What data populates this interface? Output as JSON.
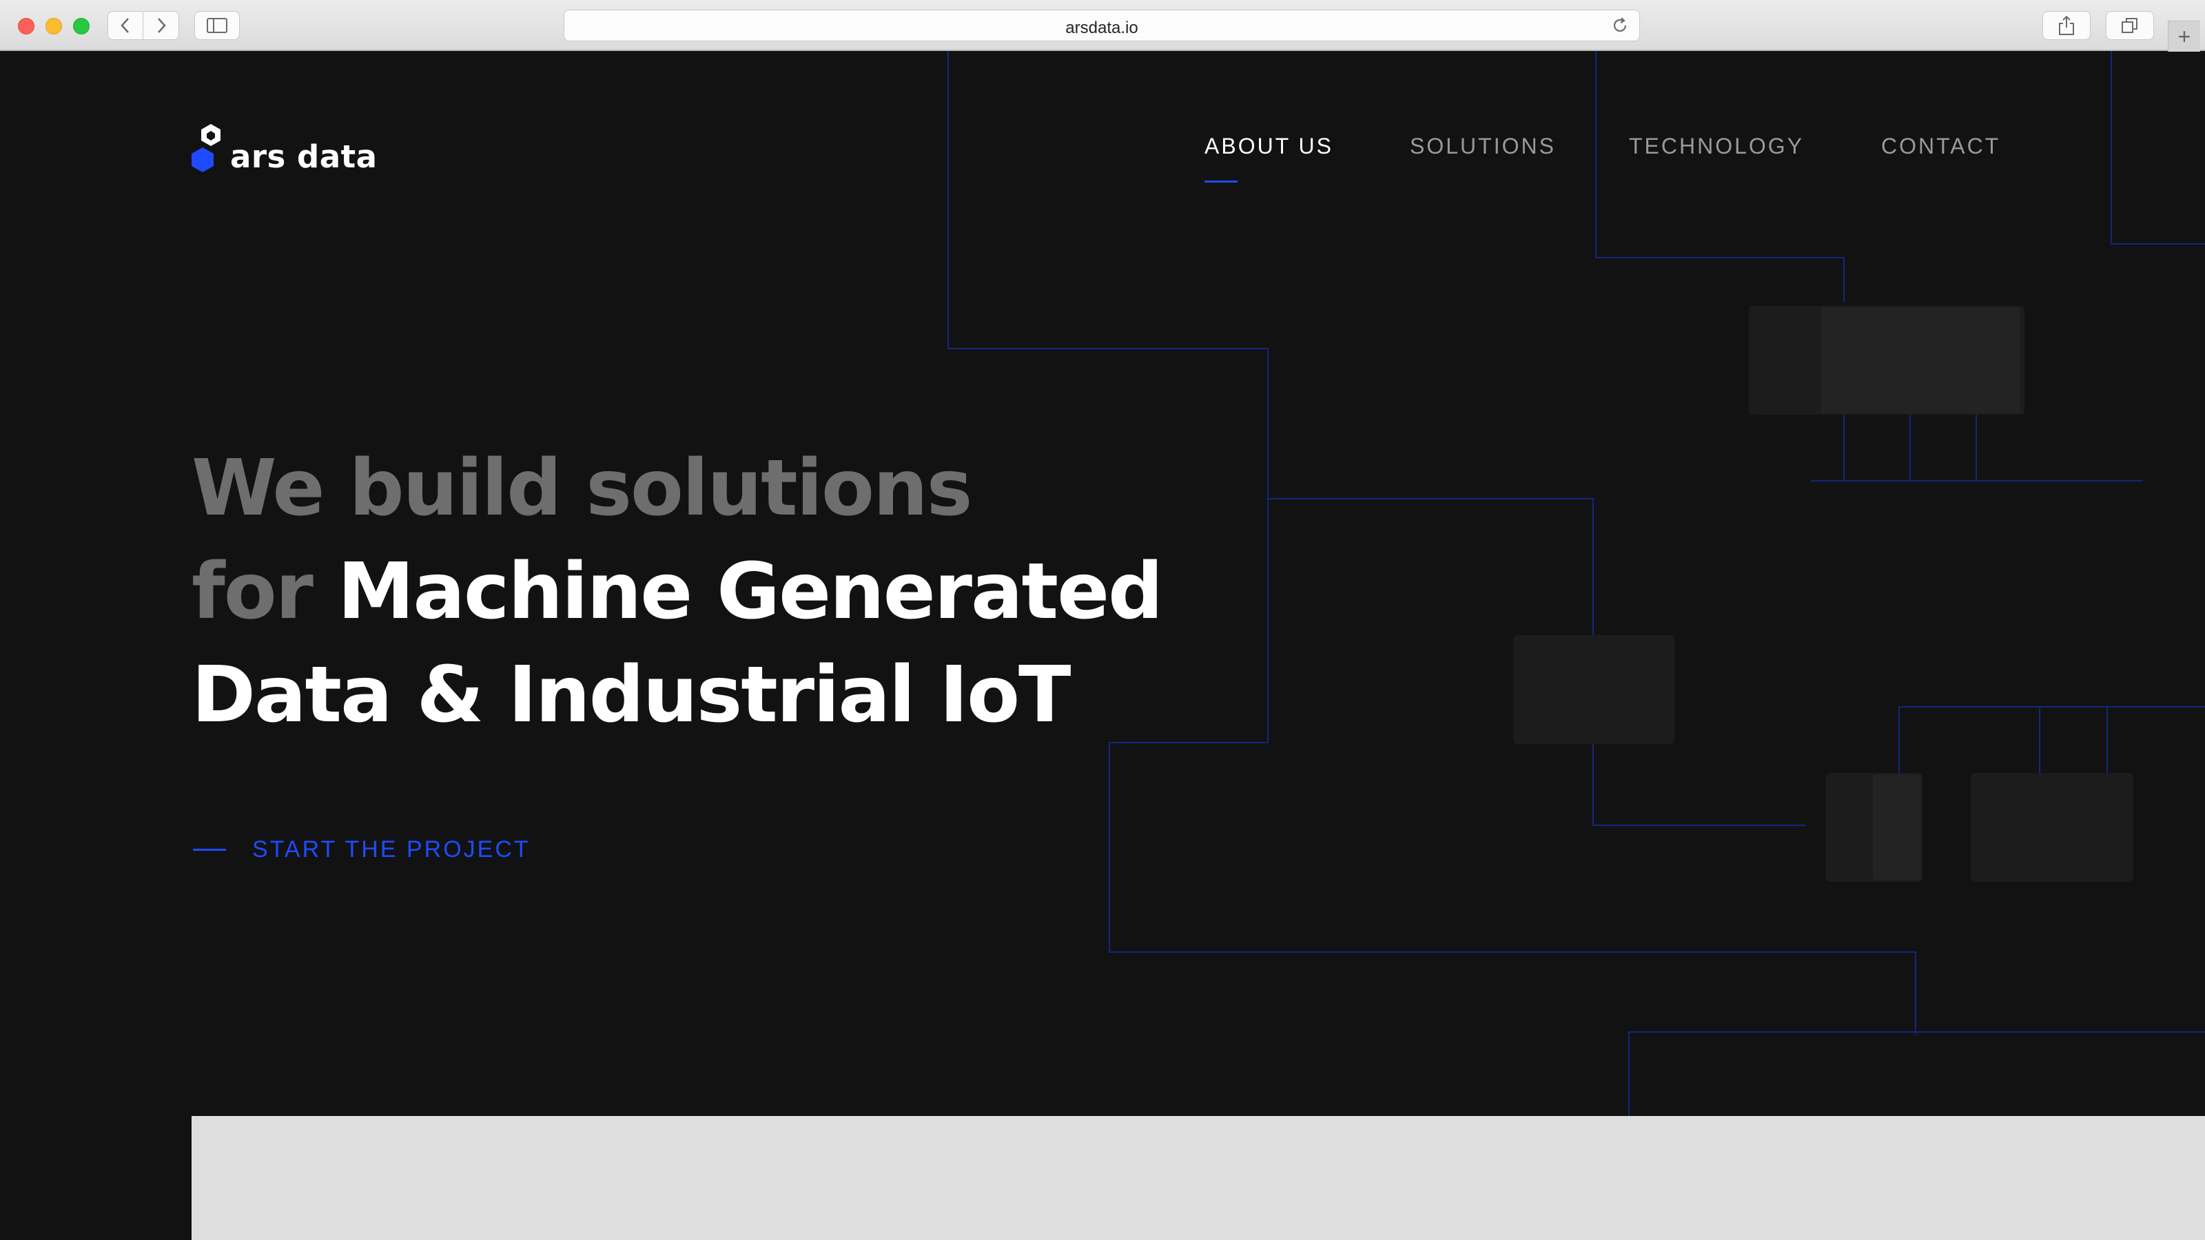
{
  "browser": {
    "url": "arsdata.io",
    "new_tab_symbol": "+"
  },
  "brand": {
    "name": "ars data",
    "accent_color": "#1f4bff"
  },
  "nav": {
    "items": [
      {
        "label": "ABOUT US",
        "active": true
      },
      {
        "label": "SOLUTIONS",
        "active": false
      },
      {
        "label": "TECHNOLOGY",
        "active": false
      },
      {
        "label": "CONTACT",
        "active": false
      }
    ]
  },
  "hero": {
    "line1": "We build solutions",
    "line2_muted": "for",
    "line2_bright": "Machine Generated",
    "line3": "Data & Industrial IoT"
  },
  "cta": {
    "label": "START THE PROJECT"
  },
  "icons": [
    "close-dot-icon",
    "minimize-dot-icon",
    "zoom-dot-icon",
    "back-icon",
    "forward-icon",
    "sidebar-icon",
    "reload-icon",
    "share-icon",
    "tabs-icon",
    "hexagon-logo-icon"
  ]
}
